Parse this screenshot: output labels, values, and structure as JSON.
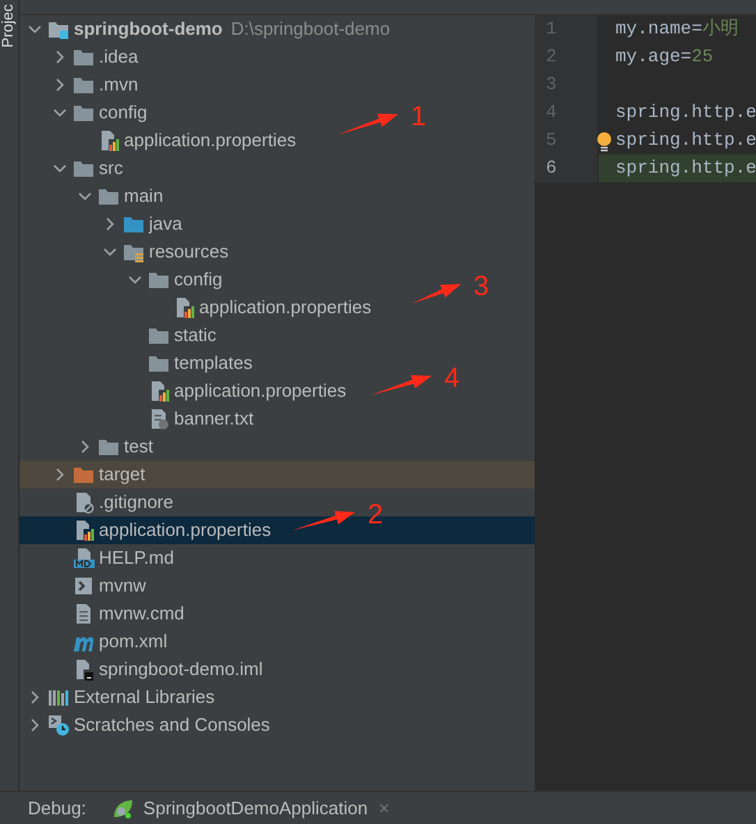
{
  "side_tab": {
    "label": "Projec"
  },
  "tree": [
    {
      "name": "springboot-demo",
      "path": "D:\\springboot-demo",
      "kind": "module",
      "expanded": true,
      "selected": false,
      "children": [
        {
          "name": ".idea",
          "kind": "folder",
          "expanded": false,
          "selected": false
        },
        {
          "name": ".mvn",
          "kind": "folder",
          "expanded": false,
          "selected": false
        },
        {
          "name": "config",
          "kind": "folder",
          "expanded": true,
          "selected": false,
          "children": [
            {
              "name": "application.properties",
              "kind": "properties",
              "selected": false
            }
          ]
        },
        {
          "name": "src",
          "kind": "folder",
          "expanded": true,
          "selected": false,
          "children": [
            {
              "name": "main",
              "kind": "folder",
              "expanded": true,
              "selected": false,
              "children": [
                {
                  "name": "java",
                  "kind": "source",
                  "expanded": false,
                  "selected": false
                },
                {
                  "name": "resources",
                  "kind": "resources",
                  "expanded": true,
                  "selected": false,
                  "children": [
                    {
                      "name": "config",
                      "kind": "folder",
                      "expanded": true,
                      "selected": false,
                      "children": [
                        {
                          "name": "application.properties",
                          "kind": "properties",
                          "selected": false
                        }
                      ]
                    },
                    {
                      "name": "static",
                      "kind": "folder",
                      "selected": false
                    },
                    {
                      "name": "templates",
                      "kind": "folder",
                      "selected": false
                    },
                    {
                      "name": "application.properties",
                      "kind": "properties",
                      "selected": false
                    },
                    {
                      "name": "banner.txt",
                      "kind": "text",
                      "selected": false
                    }
                  ]
                }
              ]
            },
            {
              "name": "test",
              "kind": "folder",
              "expanded": false,
              "selected": false
            }
          ]
        },
        {
          "name": "target",
          "kind": "excluded",
          "expanded": false,
          "selected": false
        },
        {
          "name": ".gitignore",
          "kind": "gitignore",
          "selected": false
        },
        {
          "name": "application.properties",
          "kind": "properties",
          "selected": true
        },
        {
          "name": "HELP.md",
          "kind": "markdown",
          "selected": false
        },
        {
          "name": "mvnw",
          "kind": "shell",
          "selected": false
        },
        {
          "name": "mvnw.cmd",
          "kind": "cmd",
          "selected": false
        },
        {
          "name": "pom.xml",
          "kind": "maven",
          "selected": false
        },
        {
          "name": "springboot-demo.iml",
          "kind": "iml",
          "selected": false
        }
      ]
    },
    {
      "name": "External Libraries",
      "kind": "libraries",
      "expanded": false,
      "selected": false
    },
    {
      "name": "Scratches and Consoles",
      "kind": "scratches",
      "expanded": false,
      "selected": false
    }
  ],
  "editor": {
    "lines": [
      {
        "number": "1",
        "key": "my.name=",
        "value": "小明",
        "current": false,
        "bulb": false
      },
      {
        "number": "2",
        "key": "my.age=",
        "value": "25",
        "current": false,
        "bulb": false
      },
      {
        "number": "3",
        "current": false,
        "bulb": false
      },
      {
        "number": "4",
        "key": "spring.http.e",
        "current": false,
        "bulb": false
      },
      {
        "number": "5",
        "key": "spring.http.e",
        "current": false,
        "bulb": true
      },
      {
        "number": "6",
        "key": "spring.http.e",
        "current": true,
        "bulb": false
      }
    ]
  },
  "annotations": [
    {
      "label": "1"
    },
    {
      "label": "3"
    },
    {
      "label": "4"
    },
    {
      "label": "2"
    }
  ],
  "debug_bar": {
    "label": "Debug:",
    "tab": {
      "title": "SpringbootDemoApplication",
      "close": "×"
    }
  }
}
